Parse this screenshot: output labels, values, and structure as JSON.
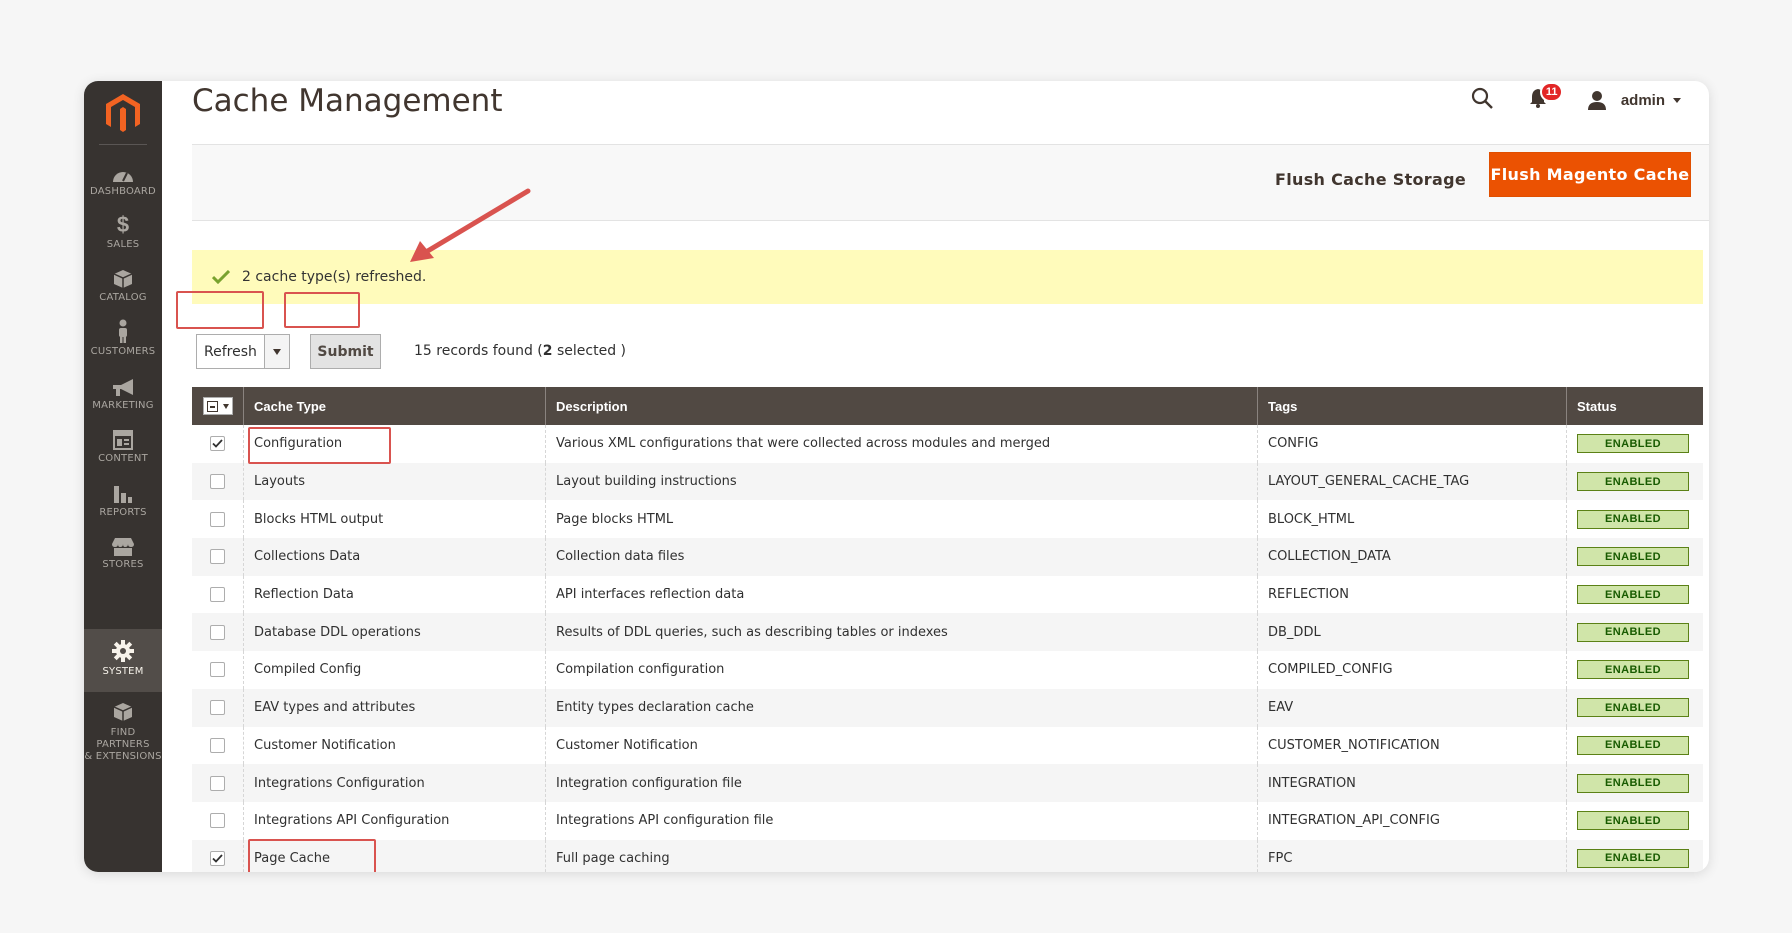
{
  "page": {
    "title": "Cache Management"
  },
  "header": {
    "user": "admin",
    "notifications_count": "11"
  },
  "sidebar": {
    "items": [
      {
        "label": "DASHBOARD",
        "icon": "dashboard-icon"
      },
      {
        "label": "SALES",
        "icon": "dollar-icon"
      },
      {
        "label": "CATALOG",
        "icon": "box-icon"
      },
      {
        "label": "CUSTOMERS",
        "icon": "person-icon"
      },
      {
        "label": "MARKETING",
        "icon": "megaphone-icon"
      },
      {
        "label": "CONTENT",
        "icon": "layout-icon"
      },
      {
        "label": "REPORTS",
        "icon": "bar-chart-icon"
      },
      {
        "label": "STORES",
        "icon": "store-icon"
      },
      {
        "label": "SYSTEM",
        "icon": "gear-icon",
        "active": true
      },
      {
        "label": "FIND PARTNERS & EXTENSIONS",
        "label_line1": "FIND PARTNERS",
        "label_line2": "& EXTENSIONS",
        "icon": "boxes-icon"
      }
    ]
  },
  "actions": {
    "flush_storage": "Flush Cache Storage",
    "flush_magento": "Flush Magento Cache"
  },
  "message": {
    "text": "2 cache type(s) refreshed."
  },
  "massaction": {
    "selected_action": "Refresh",
    "submit_label": "Submit",
    "records_prefix": "15 records found (",
    "selected_count": "2",
    "records_suffix": " selected )"
  },
  "grid": {
    "headers": {
      "type": "Cache Type",
      "description": "Description",
      "tags": "Tags",
      "status": "Status"
    },
    "rows": [
      {
        "checked": true,
        "type": "Configuration",
        "description": "Various XML configurations that were collected across modules and merged",
        "tags": "CONFIG",
        "status": "ENABLED"
      },
      {
        "checked": false,
        "type": "Layouts",
        "description": "Layout building instructions",
        "tags": "LAYOUT_GENERAL_CACHE_TAG",
        "status": "ENABLED"
      },
      {
        "checked": false,
        "type": "Blocks HTML output",
        "description": "Page blocks HTML",
        "tags": "BLOCK_HTML",
        "status": "ENABLED"
      },
      {
        "checked": false,
        "type": "Collections Data",
        "description": "Collection data files",
        "tags": "COLLECTION_DATA",
        "status": "ENABLED"
      },
      {
        "checked": false,
        "type": "Reflection Data",
        "description": "API interfaces reflection data",
        "tags": "REFLECTION",
        "status": "ENABLED"
      },
      {
        "checked": false,
        "type": "Database DDL operations",
        "description": "Results of DDL queries, such as describing tables or indexes",
        "tags": "DB_DDL",
        "status": "ENABLED"
      },
      {
        "checked": false,
        "type": "Compiled Config",
        "description": "Compilation configuration",
        "tags": "COMPILED_CONFIG",
        "status": "ENABLED"
      },
      {
        "checked": false,
        "type": "EAV types and attributes",
        "description": "Entity types declaration cache",
        "tags": "EAV",
        "status": "ENABLED"
      },
      {
        "checked": false,
        "type": "Customer Notification",
        "description": "Customer Notification",
        "tags": "CUSTOMER_NOTIFICATION",
        "status": "ENABLED"
      },
      {
        "checked": false,
        "type": "Integrations Configuration",
        "description": "Integration configuration file",
        "tags": "INTEGRATION",
        "status": "ENABLED"
      },
      {
        "checked": false,
        "type": "Integrations API Configuration",
        "description": "Integrations API configuration file",
        "tags": "INTEGRATION_API_CONFIG",
        "status": "ENABLED"
      },
      {
        "checked": true,
        "type": "Page Cache",
        "description": "Full page caching",
        "tags": "FPC",
        "status": "ENABLED"
      }
    ]
  },
  "colors": {
    "sidebar": "#373330",
    "accent": "#eb5202",
    "grid_header": "#514943",
    "message_bg": "#fffbbb",
    "annotation": "#d9534f"
  }
}
